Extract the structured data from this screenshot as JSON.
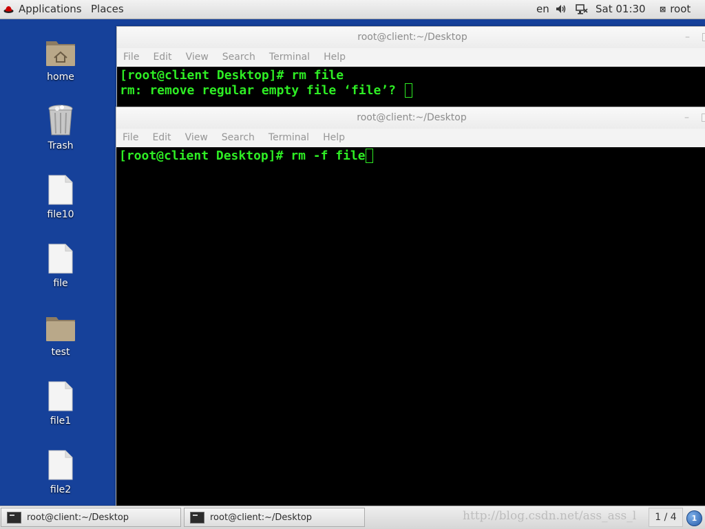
{
  "top_panel": {
    "applications": "Applications",
    "places": "Places",
    "language": "en",
    "clock": "Sat 01:30",
    "user": "root"
  },
  "desktop_icons": [
    {
      "label": "home",
      "icon": "home-folder-icon"
    },
    {
      "label": "Trash",
      "icon": "trash-icon"
    },
    {
      "label": "file10",
      "icon": "file-icon"
    },
    {
      "label": "file",
      "icon": "file-icon"
    },
    {
      "label": "test",
      "icon": "folder-icon"
    },
    {
      "label": "file1",
      "icon": "file-icon"
    },
    {
      "label": "file2",
      "icon": "file-icon"
    }
  ],
  "terminal_back": {
    "title": "root@client:~/Desktop",
    "menu": [
      "File",
      "Edit",
      "View",
      "Search",
      "Terminal",
      "Help"
    ],
    "lines": [
      "[root@client Desktop]# rm file",
      "rm: remove regular empty file ‘file’? "
    ]
  },
  "terminal_front": {
    "title": "root@client:~/Desktop",
    "menu": [
      "File",
      "Edit",
      "View",
      "Search",
      "Terminal",
      "Help"
    ],
    "lines": [
      "[root@client Desktop]# rm -f file"
    ]
  },
  "taskbar": {
    "tasks": [
      "root@client:~/Desktop",
      "root@client:~/Desktop"
    ],
    "watermark": "http://blog.csdn.net/ass_ass_l",
    "workspace": "1 / 4",
    "notifications": "1"
  },
  "colors": {
    "desktop": "#16419a",
    "terminal_text": "#2eed24",
    "terminal_bg": "#000000"
  }
}
